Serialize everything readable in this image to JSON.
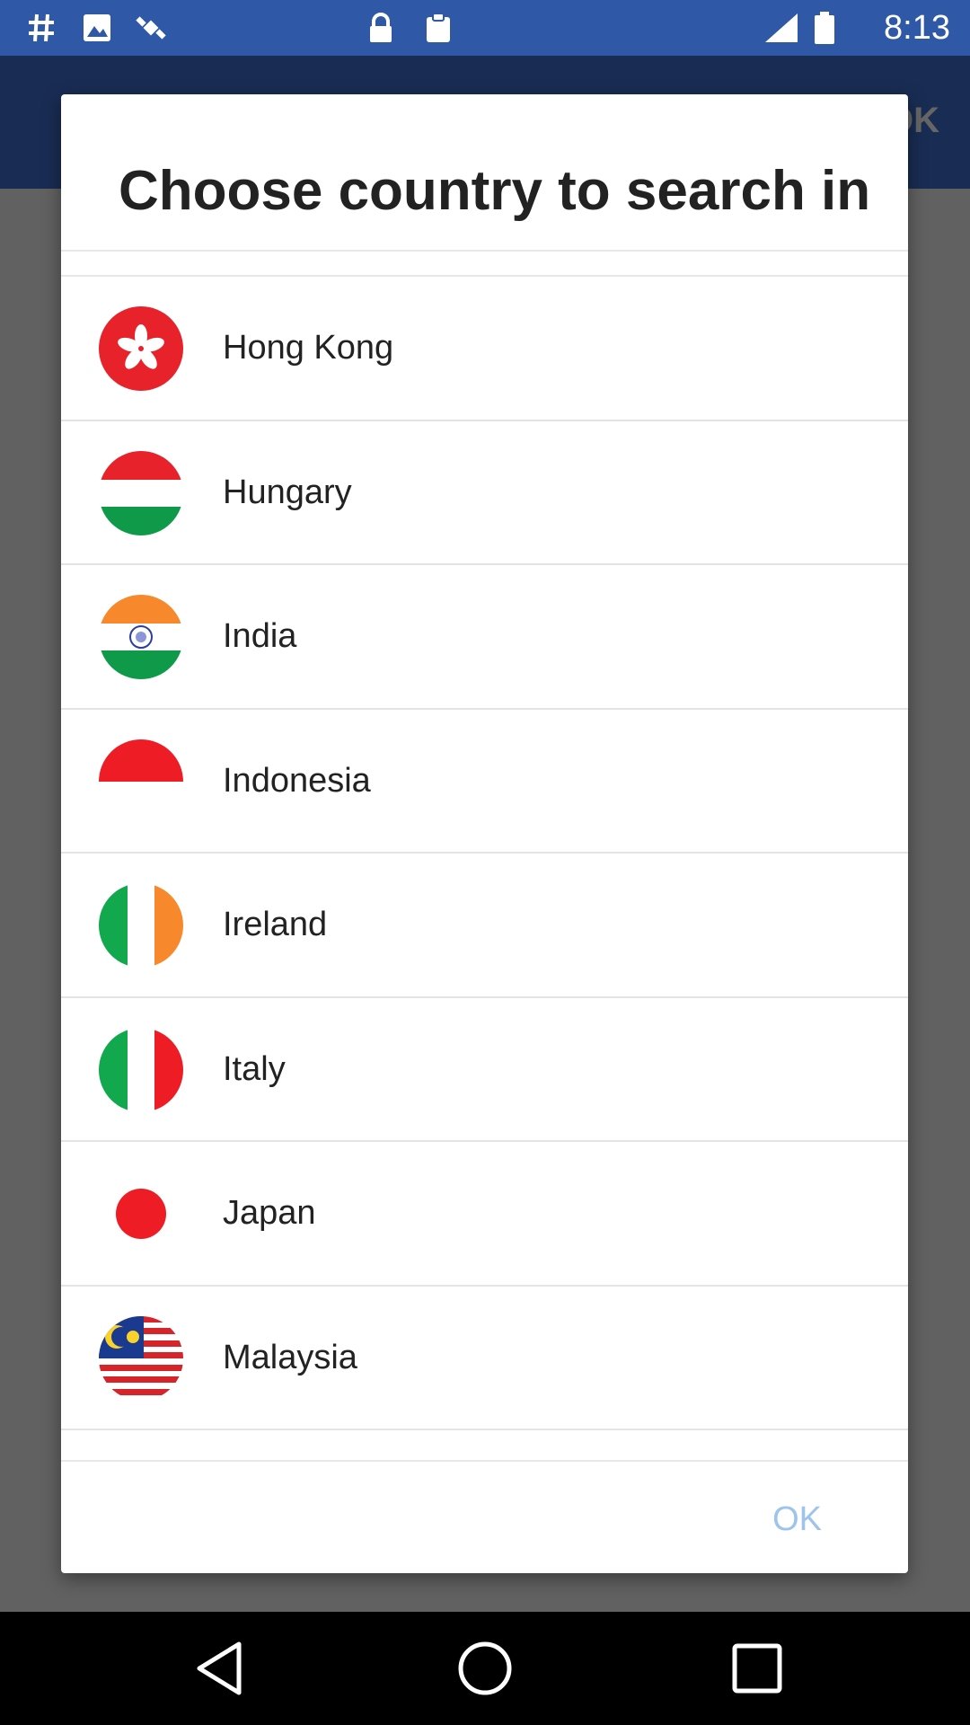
{
  "status_bar": {
    "time": "8:13",
    "icons": [
      "hashtag-icon",
      "photos-icon",
      "fake-gps-icon",
      "lock-icon",
      "clipboard-icon",
      "signal-icon",
      "battery-icon"
    ]
  },
  "background_app": {
    "toolbar_ok": "OK",
    "toolbar_color": "#3f6fd0"
  },
  "dialog": {
    "title": "Choose country to search in",
    "countries": [
      {
        "name": "Hong Kong",
        "flag": "hong-kong-flag-icon"
      },
      {
        "name": "Hungary",
        "flag": "hungary-flag-icon"
      },
      {
        "name": "India",
        "flag": "india-flag-icon"
      },
      {
        "name": "Indonesia",
        "flag": "indonesia-flag-icon"
      },
      {
        "name": "Ireland",
        "flag": "ireland-flag-icon"
      },
      {
        "name": "Italy",
        "flag": "italy-flag-icon"
      },
      {
        "name": "Japan",
        "flag": "japan-flag-icon"
      },
      {
        "name": "Malaysia",
        "flag": "malaysia-flag-icon"
      }
    ],
    "ok_label": "OK",
    "ok_color": "#9cc4ec"
  },
  "nav_bar": {
    "buttons": [
      "back-icon",
      "home-icon",
      "recents-icon"
    ]
  }
}
